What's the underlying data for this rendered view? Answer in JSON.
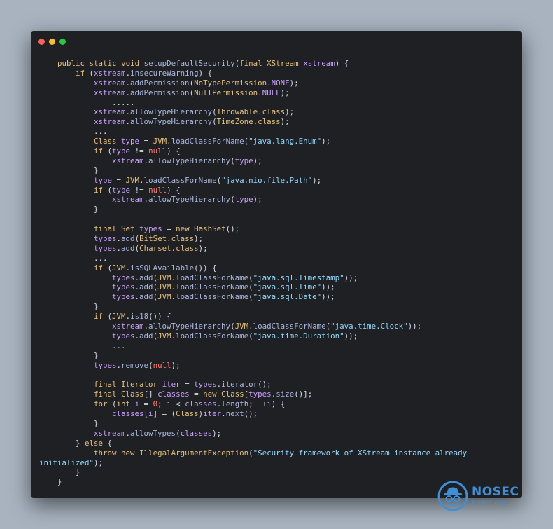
{
  "window": {
    "traffic_lights": [
      {
        "name": "close",
        "color": "#ff5f57"
      },
      {
        "name": "minimize",
        "color": "#febc2e"
      },
      {
        "name": "zoom",
        "color": "#28c840"
      }
    ]
  },
  "code_lines": [
    [
      [
        "    ",
        "p"
      ],
      [
        "public",
        "k"
      ],
      [
        " ",
        "p"
      ],
      [
        "static",
        "k"
      ],
      [
        " ",
        "p"
      ],
      [
        "void",
        "k"
      ],
      [
        " ",
        "p"
      ],
      [
        "setupDefaultSecurity",
        "f"
      ],
      [
        "(",
        "p"
      ],
      [
        "final",
        "k"
      ],
      [
        " ",
        "p"
      ],
      [
        "XStream",
        "t"
      ],
      [
        " ",
        "p"
      ],
      [
        "xstream",
        "v"
      ],
      [
        ") {",
        "p"
      ]
    ],
    [
      [
        "        ",
        "p"
      ],
      [
        "if",
        "k"
      ],
      [
        " (",
        "p"
      ],
      [
        "xstream",
        "v"
      ],
      [
        ".",
        "p"
      ],
      [
        "insecureWarning",
        "f"
      ],
      [
        ") {",
        "p"
      ]
    ],
    [
      [
        "            ",
        "p"
      ],
      [
        "xstream",
        "v"
      ],
      [
        ".",
        "p"
      ],
      [
        "addPermission",
        "f"
      ],
      [
        "(",
        "p"
      ],
      [
        "NoTypePermission",
        "t"
      ],
      [
        ".",
        "p"
      ],
      [
        "NONE",
        "v"
      ],
      [
        ");",
        "p"
      ]
    ],
    [
      [
        "            ",
        "p"
      ],
      [
        "xstream",
        "v"
      ],
      [
        ".",
        "p"
      ],
      [
        "addPermission",
        "f"
      ],
      [
        "(",
        "p"
      ],
      [
        "NullPermission",
        "t"
      ],
      [
        ".",
        "p"
      ],
      [
        "NULL",
        "v"
      ],
      [
        ");",
        "p"
      ]
    ],
    [
      [
        "                .....",
        "p"
      ]
    ],
    [
      [
        "            ",
        "p"
      ],
      [
        "xstream",
        "v"
      ],
      [
        ".",
        "p"
      ],
      [
        "allowTypeHierarchy",
        "f"
      ],
      [
        "(",
        "p"
      ],
      [
        "Throwable",
        "t"
      ],
      [
        ".",
        "p"
      ],
      [
        "class",
        "k"
      ],
      [
        ");",
        "p"
      ]
    ],
    [
      [
        "            ",
        "p"
      ],
      [
        "xstream",
        "v"
      ],
      [
        ".",
        "p"
      ],
      [
        "allowTypeHierarchy",
        "f"
      ],
      [
        "(",
        "p"
      ],
      [
        "TimeZone",
        "t"
      ],
      [
        ".",
        "p"
      ],
      [
        "class",
        "k"
      ],
      [
        ");",
        "p"
      ]
    ],
    [
      [
        "            ...",
        "p"
      ]
    ],
    [
      [
        "            ",
        "p"
      ],
      [
        "Class",
        "t"
      ],
      [
        " ",
        "p"
      ],
      [
        "type",
        "v"
      ],
      [
        " = ",
        "p"
      ],
      [
        "JVM",
        "t"
      ],
      [
        ".",
        "p"
      ],
      [
        "loadClassForName",
        "f"
      ],
      [
        "(",
        "p"
      ],
      [
        "\"java.lang.Enum\"",
        "s"
      ],
      [
        ");",
        "p"
      ]
    ],
    [
      [
        "            ",
        "p"
      ],
      [
        "if",
        "k"
      ],
      [
        " (",
        "p"
      ],
      [
        "type",
        "v"
      ],
      [
        " != ",
        "p"
      ],
      [
        "null",
        "n"
      ],
      [
        ") {",
        "p"
      ]
    ],
    [
      [
        "                ",
        "p"
      ],
      [
        "xstream",
        "v"
      ],
      [
        ".",
        "p"
      ],
      [
        "allowTypeHierarchy",
        "f"
      ],
      [
        "(",
        "p"
      ],
      [
        "type",
        "v"
      ],
      [
        ");",
        "p"
      ]
    ],
    [
      [
        "            }",
        "p"
      ]
    ],
    [
      [
        "            ",
        "p"
      ],
      [
        "type",
        "v"
      ],
      [
        " = ",
        "p"
      ],
      [
        "JVM",
        "t"
      ],
      [
        ".",
        "p"
      ],
      [
        "loadClassForName",
        "f"
      ],
      [
        "(",
        "p"
      ],
      [
        "\"java.nio.file.Path\"",
        "s"
      ],
      [
        ");",
        "p"
      ]
    ],
    [
      [
        "            ",
        "p"
      ],
      [
        "if",
        "k"
      ],
      [
        " (",
        "p"
      ],
      [
        "type",
        "v"
      ],
      [
        " != ",
        "p"
      ],
      [
        "null",
        "n"
      ],
      [
        ") {",
        "p"
      ]
    ],
    [
      [
        "                ",
        "p"
      ],
      [
        "xstream",
        "v"
      ],
      [
        ".",
        "p"
      ],
      [
        "allowTypeHierarchy",
        "f"
      ],
      [
        "(",
        "p"
      ],
      [
        "type",
        "v"
      ],
      [
        ");",
        "p"
      ]
    ],
    [
      [
        "            }",
        "p"
      ]
    ],
    [
      [
        "",
        "p"
      ]
    ],
    [
      [
        "            ",
        "p"
      ],
      [
        "final",
        "k"
      ],
      [
        " ",
        "p"
      ],
      [
        "Set",
        "t"
      ],
      [
        " ",
        "p"
      ],
      [
        "types",
        "v"
      ],
      [
        " = ",
        "p"
      ],
      [
        "new",
        "k"
      ],
      [
        " ",
        "p"
      ],
      [
        "HashSet",
        "t"
      ],
      [
        "();",
        "p"
      ]
    ],
    [
      [
        "            ",
        "p"
      ],
      [
        "types",
        "v"
      ],
      [
        ".",
        "p"
      ],
      [
        "add",
        "f"
      ],
      [
        "(",
        "p"
      ],
      [
        "BitSet",
        "t"
      ],
      [
        ".",
        "p"
      ],
      [
        "class",
        "k"
      ],
      [
        ");",
        "p"
      ]
    ],
    [
      [
        "            ",
        "p"
      ],
      [
        "types",
        "v"
      ],
      [
        ".",
        "p"
      ],
      [
        "add",
        "f"
      ],
      [
        "(",
        "p"
      ],
      [
        "Charset",
        "t"
      ],
      [
        ".",
        "p"
      ],
      [
        "class",
        "k"
      ],
      [
        ");",
        "p"
      ]
    ],
    [
      [
        "            ...",
        "p"
      ]
    ],
    [
      [
        "            ",
        "p"
      ],
      [
        "if",
        "k"
      ],
      [
        " (",
        "p"
      ],
      [
        "JVM",
        "t"
      ],
      [
        ".",
        "p"
      ],
      [
        "isSQLAvailable",
        "f"
      ],
      [
        "()) {",
        "p"
      ]
    ],
    [
      [
        "                ",
        "p"
      ],
      [
        "types",
        "v"
      ],
      [
        ".",
        "p"
      ],
      [
        "add",
        "f"
      ],
      [
        "(",
        "p"
      ],
      [
        "JVM",
        "t"
      ],
      [
        ".",
        "p"
      ],
      [
        "loadClassForName",
        "f"
      ],
      [
        "(",
        "p"
      ],
      [
        "\"java.sql.Timestamp\"",
        "s"
      ],
      [
        "));",
        "p"
      ]
    ],
    [
      [
        "                ",
        "p"
      ],
      [
        "types",
        "v"
      ],
      [
        ".",
        "p"
      ],
      [
        "add",
        "f"
      ],
      [
        "(",
        "p"
      ],
      [
        "JVM",
        "t"
      ],
      [
        ".",
        "p"
      ],
      [
        "loadClassForName",
        "f"
      ],
      [
        "(",
        "p"
      ],
      [
        "\"java.sql.Time\"",
        "s"
      ],
      [
        "));",
        "p"
      ]
    ],
    [
      [
        "                ",
        "p"
      ],
      [
        "types",
        "v"
      ],
      [
        ".",
        "p"
      ],
      [
        "add",
        "f"
      ],
      [
        "(",
        "p"
      ],
      [
        "JVM",
        "t"
      ],
      [
        ".",
        "p"
      ],
      [
        "loadClassForName",
        "f"
      ],
      [
        "(",
        "p"
      ],
      [
        "\"java.sql.Date\"",
        "s"
      ],
      [
        "));",
        "p"
      ]
    ],
    [
      [
        "            }",
        "p"
      ]
    ],
    [
      [
        "            ",
        "p"
      ],
      [
        "if",
        "k"
      ],
      [
        " (",
        "p"
      ],
      [
        "JVM",
        "t"
      ],
      [
        ".",
        "p"
      ],
      [
        "is18",
        "f"
      ],
      [
        "()) {",
        "p"
      ]
    ],
    [
      [
        "                ",
        "p"
      ],
      [
        "xstream",
        "v"
      ],
      [
        ".",
        "p"
      ],
      [
        "allowTypeHierarchy",
        "f"
      ],
      [
        "(",
        "p"
      ],
      [
        "JVM",
        "t"
      ],
      [
        ".",
        "p"
      ],
      [
        "loadClassForName",
        "f"
      ],
      [
        "(",
        "p"
      ],
      [
        "\"java.time.Clock\"",
        "s"
      ],
      [
        "));",
        "p"
      ]
    ],
    [
      [
        "                ",
        "p"
      ],
      [
        "types",
        "v"
      ],
      [
        ".",
        "p"
      ],
      [
        "add",
        "f"
      ],
      [
        "(",
        "p"
      ],
      [
        "JVM",
        "t"
      ],
      [
        ".",
        "p"
      ],
      [
        "loadClassForName",
        "f"
      ],
      [
        "(",
        "p"
      ],
      [
        "\"java.time.Duration\"",
        "s"
      ],
      [
        "));",
        "p"
      ]
    ],
    [
      [
        "                ...",
        "p"
      ]
    ],
    [
      [
        "            }",
        "p"
      ]
    ],
    [
      [
        "            ",
        "p"
      ],
      [
        "types",
        "v"
      ],
      [
        ".",
        "p"
      ],
      [
        "remove",
        "f"
      ],
      [
        "(",
        "p"
      ],
      [
        "null",
        "n"
      ],
      [
        ");",
        "p"
      ]
    ],
    [
      [
        "",
        "p"
      ]
    ],
    [
      [
        "            ",
        "p"
      ],
      [
        "final",
        "k"
      ],
      [
        " ",
        "p"
      ],
      [
        "Iterator",
        "t"
      ],
      [
        " ",
        "p"
      ],
      [
        "iter",
        "v"
      ],
      [
        " = ",
        "p"
      ],
      [
        "types",
        "v"
      ],
      [
        ".",
        "p"
      ],
      [
        "iterator",
        "f"
      ],
      [
        "();",
        "p"
      ]
    ],
    [
      [
        "            ",
        "p"
      ],
      [
        "final",
        "k"
      ],
      [
        " ",
        "p"
      ],
      [
        "Class",
        "t"
      ],
      [
        "[] ",
        "p"
      ],
      [
        "classes",
        "v"
      ],
      [
        " = ",
        "p"
      ],
      [
        "new",
        "k"
      ],
      [
        " ",
        "p"
      ],
      [
        "Class",
        "t"
      ],
      [
        "[",
        "p"
      ],
      [
        "types",
        "v"
      ],
      [
        ".",
        "p"
      ],
      [
        "size",
        "f"
      ],
      [
        "()];",
        "p"
      ]
    ],
    [
      [
        "            ",
        "p"
      ],
      [
        "for",
        "k"
      ],
      [
        " (",
        "p"
      ],
      [
        "int",
        "k"
      ],
      [
        " ",
        "p"
      ],
      [
        "i",
        "v"
      ],
      [
        " = ",
        "p"
      ],
      [
        "0",
        "n"
      ],
      [
        "; ",
        "p"
      ],
      [
        "i",
        "v"
      ],
      [
        " < ",
        "p"
      ],
      [
        "classes",
        "v"
      ],
      [
        ".",
        "p"
      ],
      [
        "length",
        "f"
      ],
      [
        "; ++",
        "p"
      ],
      [
        "i",
        "v"
      ],
      [
        ") {",
        "p"
      ]
    ],
    [
      [
        "                ",
        "p"
      ],
      [
        "classes",
        "v"
      ],
      [
        "[",
        "p"
      ],
      [
        "i",
        "v"
      ],
      [
        "] = (",
        "p"
      ],
      [
        "Class",
        "t"
      ],
      [
        ")",
        "p"
      ],
      [
        "iter",
        "v"
      ],
      [
        ".",
        "p"
      ],
      [
        "next",
        "f"
      ],
      [
        "();",
        "p"
      ]
    ],
    [
      [
        "            }",
        "p"
      ]
    ],
    [
      [
        "            ",
        "p"
      ],
      [
        "xstream",
        "v"
      ],
      [
        ".",
        "p"
      ],
      [
        "allowTypes",
        "f"
      ],
      [
        "(",
        "p"
      ],
      [
        "classes",
        "v"
      ],
      [
        ");",
        "p"
      ]
    ],
    [
      [
        "        } ",
        "p"
      ],
      [
        "else",
        "k"
      ],
      [
        " {",
        "p"
      ]
    ],
    [
      [
        "            ",
        "p"
      ],
      [
        "throw",
        "k"
      ],
      [
        " ",
        "p"
      ],
      [
        "new",
        "k"
      ],
      [
        " ",
        "p"
      ],
      [
        "IllegalArgumentException",
        "t"
      ],
      [
        "(",
        "p"
      ],
      [
        "\"Security framework of XStream instance already",
        "s"
      ]
    ],
    [
      [
        "initialized\"",
        "s"
      ],
      [
        ");",
        "p"
      ]
    ],
    [
      [
        "        }",
        "p"
      ]
    ],
    [
      [
        "    }",
        "p"
      ]
    ]
  ],
  "logo": {
    "name": "NOSEC",
    "url": "nosec.org",
    "color": "#3f8fd8",
    "icon": "spy-hat-icon"
  }
}
